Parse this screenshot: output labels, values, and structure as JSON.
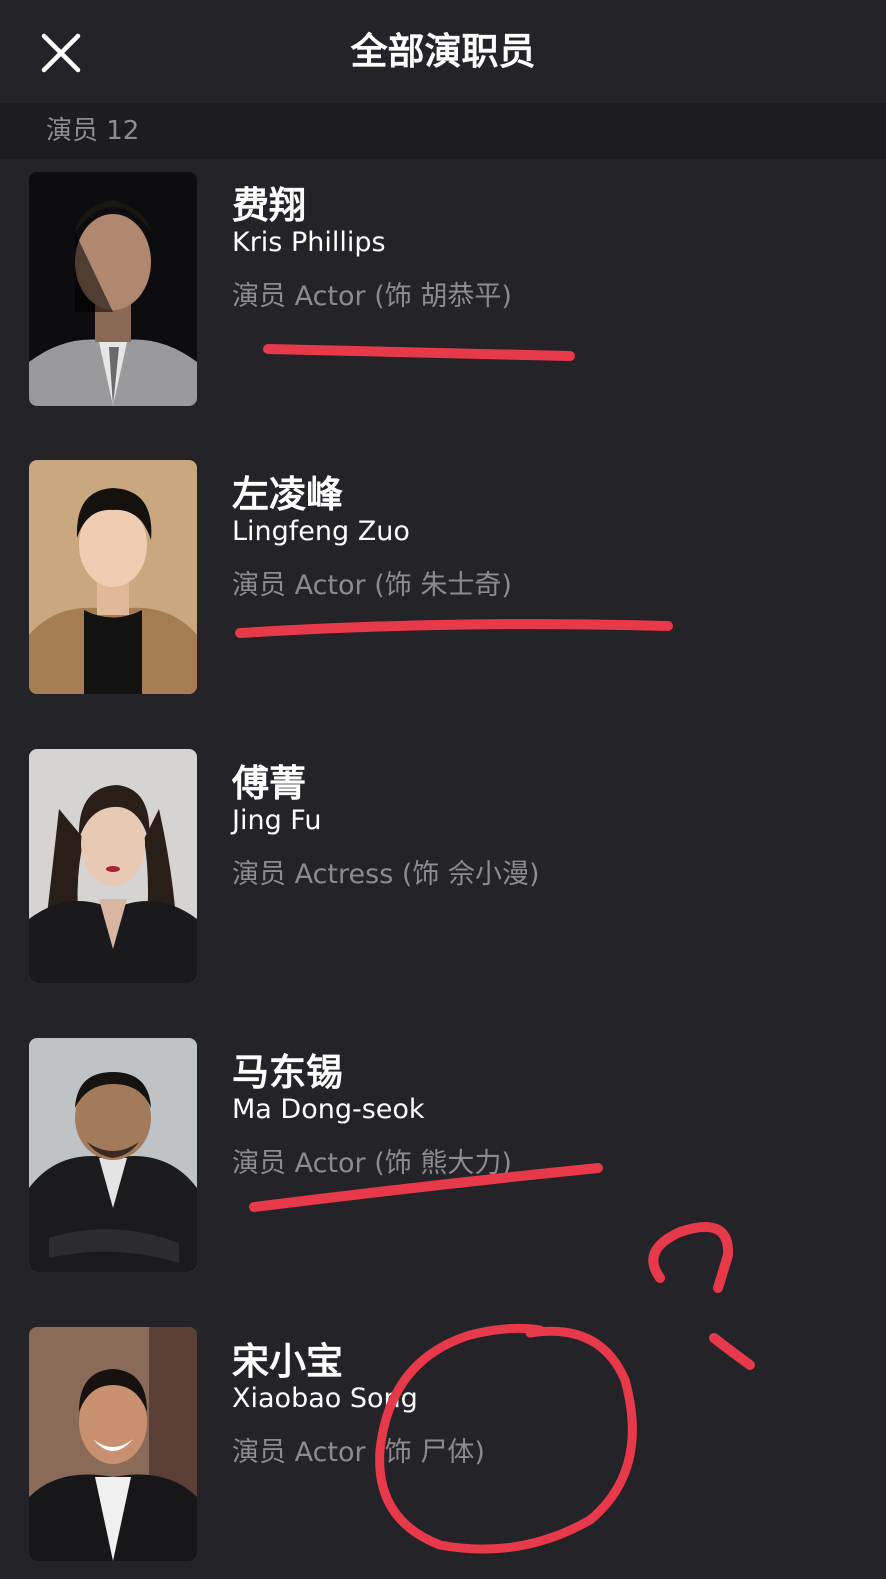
{
  "header": {
    "title": "全部演职员",
    "close_icon": "close-icon"
  },
  "section": {
    "label": "演员 12"
  },
  "cast": [
    {
      "name_cn": "费翔",
      "name_en": "Kris Phillips",
      "role": "演员 Actor (饰 胡恭平)"
    },
    {
      "name_cn": "左凌峰",
      "name_en": "Lingfeng Zuo",
      "role": "演员 Actor (饰 朱士奇)"
    },
    {
      "name_cn": "傅菁",
      "name_en": "Jing Fu",
      "role": "演员 Actress (饰 佘小漫)"
    },
    {
      "name_cn": "马东锡",
      "name_en": "Ma Dong-seok",
      "role": "演员 Actor (饰 熊大力)"
    },
    {
      "name_cn": "宋小宝",
      "name_en": "Xiaobao Song",
      "role": "演员 Actor (饰 尸体)"
    }
  ],
  "colors": {
    "background": "#242327",
    "section_bar": "#1d1c1f",
    "secondary_text": "#8c8b90",
    "annotation_red": "#e8394a"
  }
}
